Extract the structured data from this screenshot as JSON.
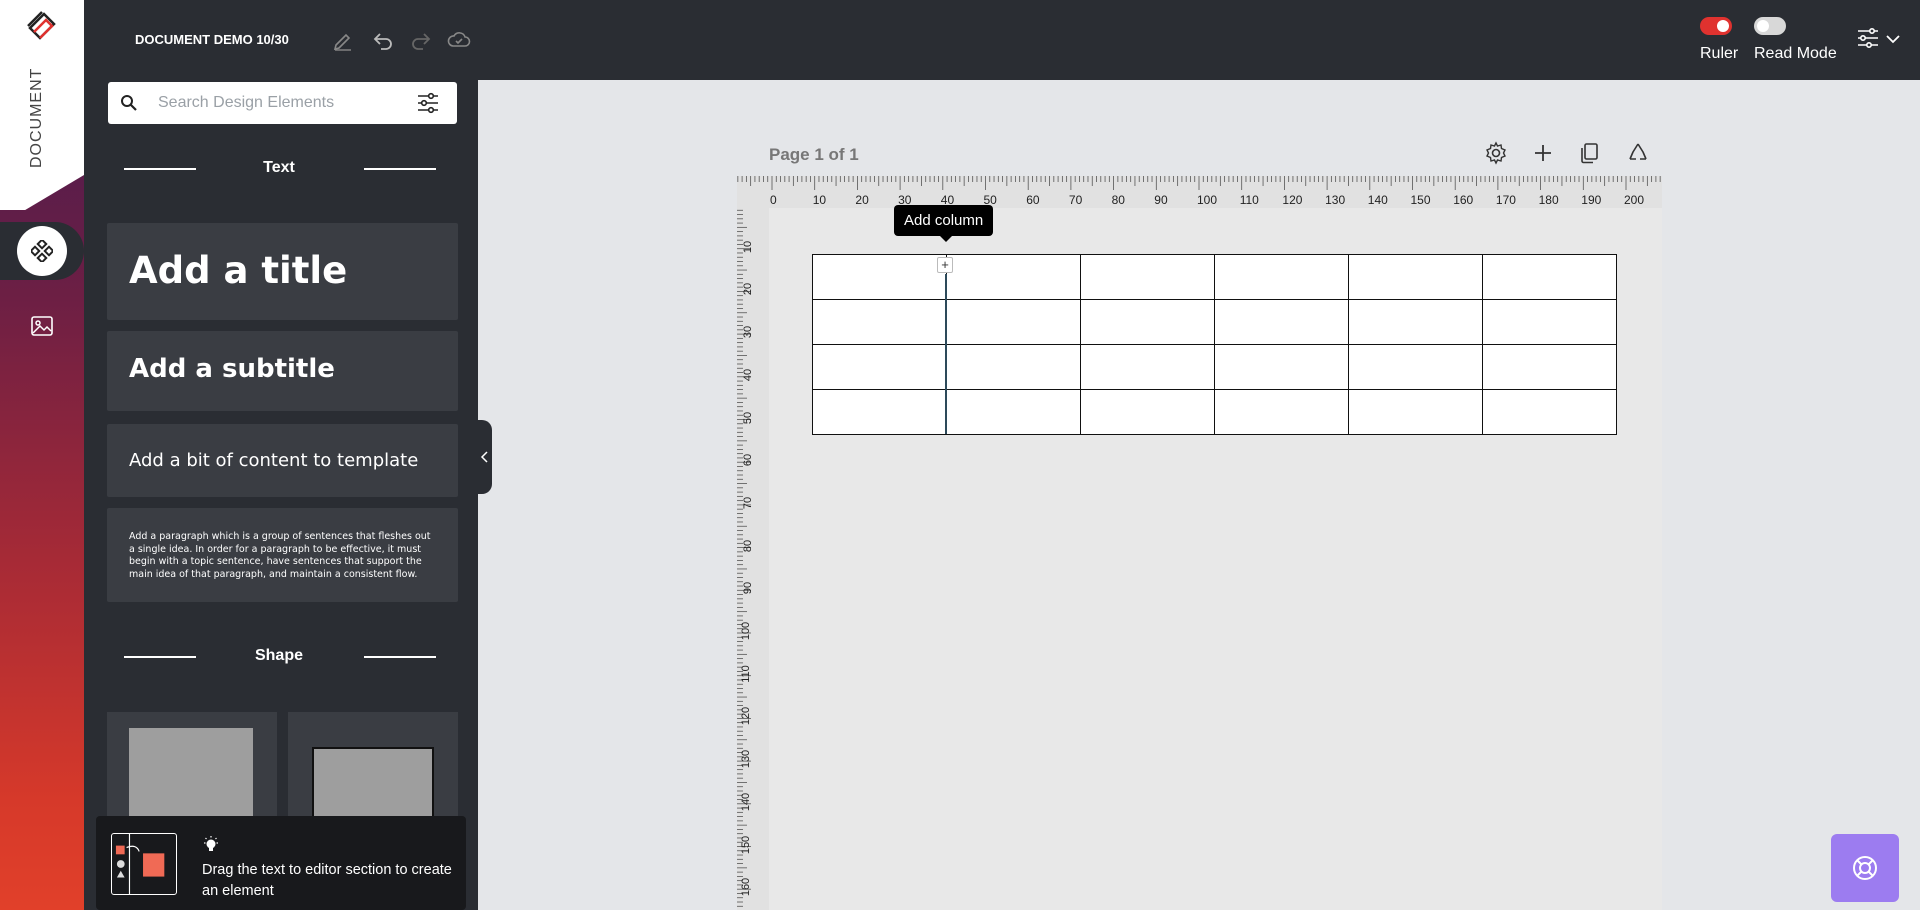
{
  "rail": {
    "label": "DOCUMENT",
    "items": [
      {
        "name": "design-elements",
        "icon": "elements-icon",
        "active": true
      },
      {
        "name": "images",
        "icon": "image-icon",
        "active": false
      }
    ]
  },
  "topbar": {
    "title": "DOCUMENT DEMO 10/30",
    "actions": [
      "edit-icon",
      "undo-icon",
      "redo-icon",
      "cloud-save-icon"
    ],
    "ruler": {
      "label": "Ruler",
      "on": true,
      "color": "#e0322f"
    },
    "read_mode": {
      "label": "Read Mode",
      "on": false
    },
    "settings_icon": "sliders-icon"
  },
  "sidebar": {
    "search": {
      "placeholder": "Search Design Elements",
      "value": ""
    },
    "text_section": "Text",
    "cards": {
      "title": "Add a title",
      "subtitle": "Add a subtitle",
      "content": "Add a bit of content to template",
      "paragraph": "Add a paragraph which is a group of sentences that fleshes out a single idea. In order for a paragraph to be effective, it must begin with a topic sentence, have sentences that support the main idea of that paragraph, and maintain a consistent flow."
    },
    "shape_section": "Shape",
    "hint": "Drag the text to editor section to create an element"
  },
  "canvas": {
    "page_label": "Page 1 of 1",
    "page_tools": [
      "gear-icon",
      "plus-icon",
      "copy-icon",
      "recycle-icon"
    ],
    "ruler_h": [
      "0",
      "10",
      "20",
      "30",
      "40",
      "50",
      "60",
      "70",
      "80",
      "90",
      "100",
      "110",
      "120",
      "130",
      "140",
      "150",
      "160",
      "170",
      "180",
      "190",
      "200"
    ],
    "ruler_v": [
      "10",
      "20",
      "30",
      "40",
      "50",
      "60",
      "70",
      "80",
      "90",
      "100",
      "110",
      "120",
      "130",
      "140",
      "150",
      "160"
    ],
    "table": {
      "rows": 4,
      "cols": 6
    },
    "tooltip": "Add column",
    "add_col_symbol": "+"
  },
  "help": {
    "icon": "lifebuoy-icon"
  }
}
